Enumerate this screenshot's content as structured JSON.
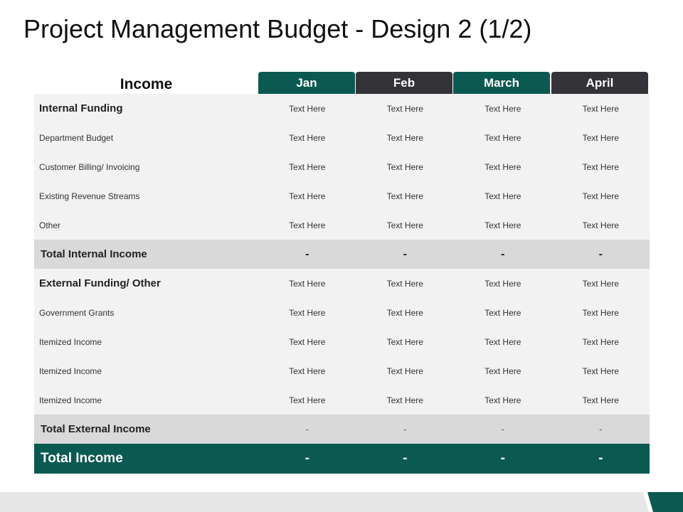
{
  "title": "Project Management Budget - Design 2 (1/2)",
  "header": {
    "label": "Income",
    "months": [
      "Jan",
      "Feb",
      "March",
      "April"
    ]
  },
  "colors": {
    "accent_green": "#0b5a52",
    "accent_dark": "#333338",
    "body_bg": "#f2f2f2",
    "subtotal_bg": "#d9d9d9"
  },
  "rows": [
    {
      "label": "Internal Funding",
      "values": [
        "Text Here",
        "Text Here",
        "Text Here",
        "Text Here"
      ]
    },
    {
      "label": "Department  Budget",
      "values": [
        "Text Here",
        "Text Here",
        "Text Here",
        "Text Here"
      ]
    },
    {
      "label": "Customer Billing/ Invoicing",
      "values": [
        "Text Here",
        "Text Here",
        "Text Here",
        "Text Here"
      ]
    },
    {
      "label": "Existing Revenue  Streams",
      "values": [
        "Text Here",
        "Text Here",
        "Text Here",
        "Text Here"
      ]
    },
    {
      "label": "Other",
      "values": [
        "Text Here",
        "Text Here",
        "Text Here",
        "Text Here"
      ]
    },
    {
      "label": "Total Internal Income",
      "values": [
        "-",
        "-",
        "-",
        "-"
      ]
    },
    {
      "label": "External Funding/ Other",
      "values": [
        "Text Here",
        "Text Here",
        "Text Here",
        "Text Here"
      ]
    },
    {
      "label": "Government  Grants",
      "values": [
        "Text Here",
        "Text Here",
        "Text Here",
        "Text Here"
      ]
    },
    {
      "label": "Itemized Income",
      "values": [
        "Text Here",
        "Text Here",
        "Text Here",
        "Text Here"
      ]
    },
    {
      "label": "Itemized Income",
      "values": [
        "Text Here",
        "Text Here",
        "Text Here",
        "Text Here"
      ]
    },
    {
      "label": "Itemized Income",
      "values": [
        "Text Here",
        "Text Here",
        "Text Here",
        "Text Here"
      ]
    },
    {
      "label": "Total External Income",
      "values": [
        "-",
        "-",
        "-",
        "-"
      ]
    },
    {
      "label": "Total Income",
      "values": [
        "-",
        "-",
        "-",
        "-"
      ]
    }
  ]
}
